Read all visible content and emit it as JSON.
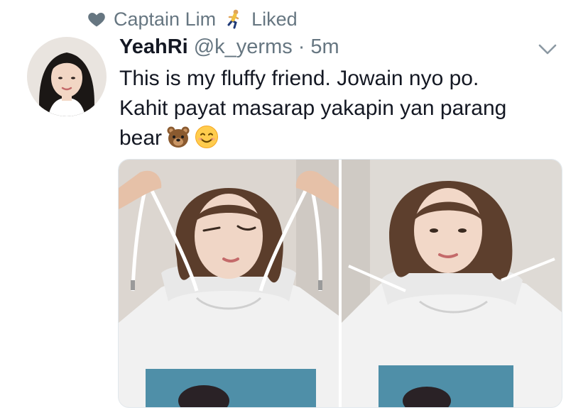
{
  "social_context": {
    "icon": "heart-icon",
    "user_name": "Captain Lim",
    "emoji": "runner-emoji",
    "action": "Liked"
  },
  "tweet": {
    "display_name": "YeahRi",
    "handle": "@k_yerms",
    "separator": "·",
    "time": "5m",
    "text_lines": [
      "This is my fluffy friend. Jowain nyo po.",
      "Kahit payat masarap yakapin yan parang",
      "bear"
    ],
    "text_emojis": [
      "bear-emoji",
      "smiling-face-emoji"
    ],
    "menu_icon": "chevron-down-icon"
  },
  "media": {
    "count": 2,
    "photos": [
      "photo-1",
      "photo-2"
    ]
  },
  "colors": {
    "secondary_text": "#667681",
    "primary_text": "#141823",
    "hoodie": "#f2f2f2",
    "print": "#4f8fa8"
  }
}
